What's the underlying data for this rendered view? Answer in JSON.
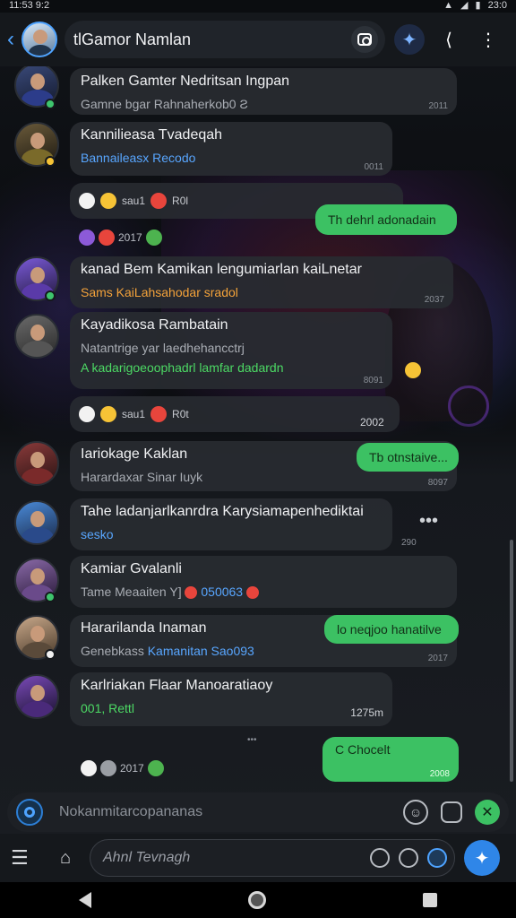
{
  "status_bar": {
    "time": "11:53 9:2",
    "battery": "23:0"
  },
  "header": {
    "title": "tlGamor Namlan"
  },
  "messages": [
    {
      "name": "Palken Gamter Nedritsan Ingpan",
      "sub": "Gamne bgar Rahnaherkob0 Ƨ",
      "time": "2011"
    },
    {
      "name": "Kannilieasa Tvadeqah",
      "sub": "Bannaileasx Recodo",
      "time": "0011"
    },
    {
      "name": "kanad Bem Kamikan lengumiarlan kaiLnetar",
      "sub": "Sams KaiLahsahodar sradol",
      "time": "2037"
    },
    {
      "name": "Kayadikosa Rambatain",
      "sub": "Natantrige yar laedhehancctrj",
      "sub2": "A kadarigoeoophadrl lamfar dadardn",
      "time": "8091"
    },
    {
      "name": "Iariokage Kaklan",
      "sub": "Harardaxar Sinar Iuyk",
      "time": "8097"
    },
    {
      "name": "Tahe ladanjarlkanrdra Karysiamapenhediktai",
      "sub": "sesko",
      "time": "290"
    },
    {
      "name": "Kamiar Gvalanli",
      "sub": "Tame Meaaiten Y]",
      "sub_link": "050063",
      "time": ""
    },
    {
      "name": "Hararilanda Inaman",
      "sub": "Genebkass",
      "sub_link": "Kamanitan Sao093",
      "time": "2017"
    },
    {
      "name": "Karlriakan Flaar Manoaratiaoy",
      "sub": "001, Rettl",
      "time": "1275m"
    }
  ],
  "outgoing": [
    {
      "text": "Th dehrl adonadain",
      "time": ""
    },
    {
      "text": "Tb otnstaive...",
      "time": "8037"
    },
    {
      "text": "lo neqjoo hanatilve",
      "time": "2011"
    },
    {
      "text": "C Chocelt",
      "time": "2008"
    }
  ],
  "reactions": [
    {
      "label": "sau1",
      "extra": "R0l"
    },
    {
      "label": "2017"
    },
    {
      "label": "sau1",
      "extra": "R0t",
      "time": "2002"
    },
    {
      "label": "2017"
    }
  ],
  "small_times": [
    "2011",
    "2000"
  ],
  "composer": {
    "placeholder": "Nokanmitarcopananas"
  },
  "toolbar": {
    "placeholder": "Ahnl Tevnagh"
  }
}
